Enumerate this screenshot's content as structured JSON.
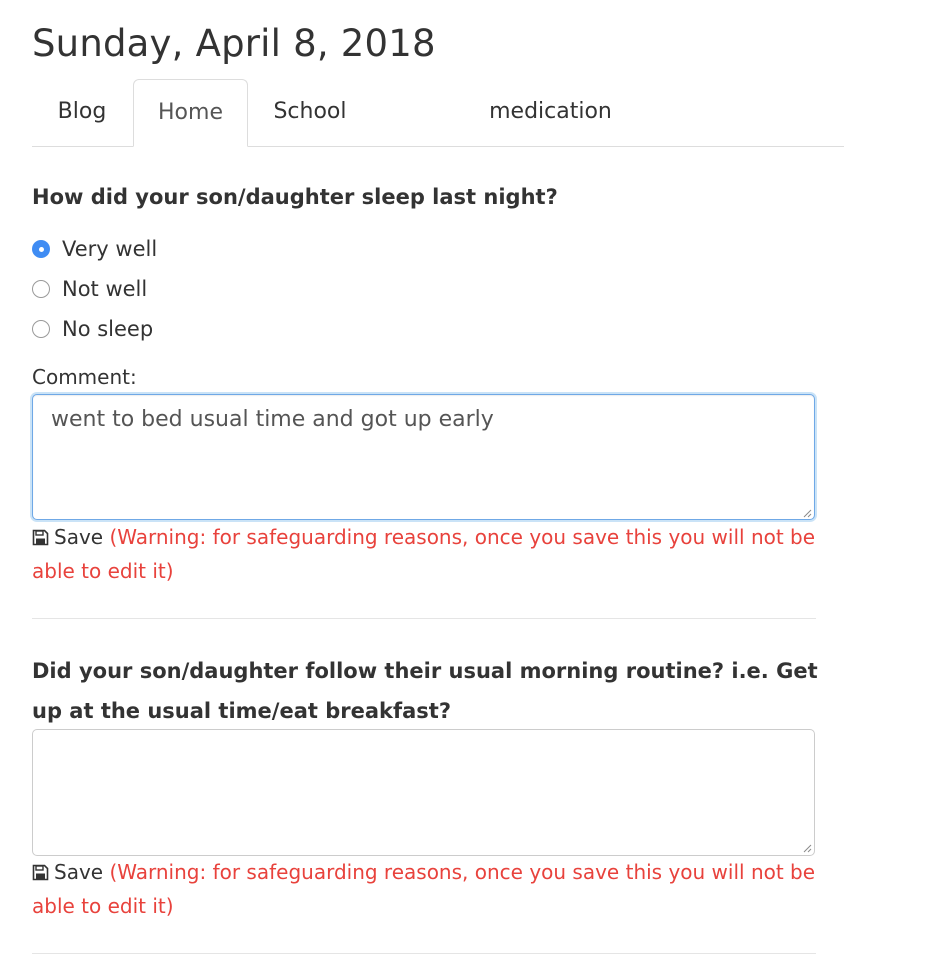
{
  "header": {
    "date": "Sunday, April 8, 2018"
  },
  "tabs": [
    {
      "label": "Blog",
      "active": false
    },
    {
      "label": "Home",
      "active": true
    },
    {
      "label": "School",
      "active": false
    },
    {
      "label": "medication",
      "active": false
    }
  ],
  "questions": [
    {
      "text": "How did your son/daughter sleep last night?",
      "options": [
        {
          "label": "Very well",
          "checked": true
        },
        {
          "label": "Not well",
          "checked": false
        },
        {
          "label": "No sleep",
          "checked": false
        }
      ],
      "comment_label": "Comment:",
      "comment_value": "went to bed usual time and got up early",
      "save_label": "Save",
      "warning": "(Warning: for safeguarding reasons, once you save this you will not be able to edit it)"
    },
    {
      "text": "Did your son/daughter follow their usual morning routine? i.e. Get up at the usual time/eat breakfast?",
      "comment_value": "",
      "save_label": "Save",
      "warning": "(Warning: for safeguarding reasons, once you save this you will not be able to edit it)"
    }
  ],
  "icons": {
    "save": "floppy-disk-icon",
    "radio": "radio-button-icon",
    "resize": "resize-grip-icon"
  },
  "colors": {
    "accent": "#3f8cf3",
    "warning": "#e8423c",
    "focus_border": "#6fa8e6",
    "text": "#333333"
  }
}
